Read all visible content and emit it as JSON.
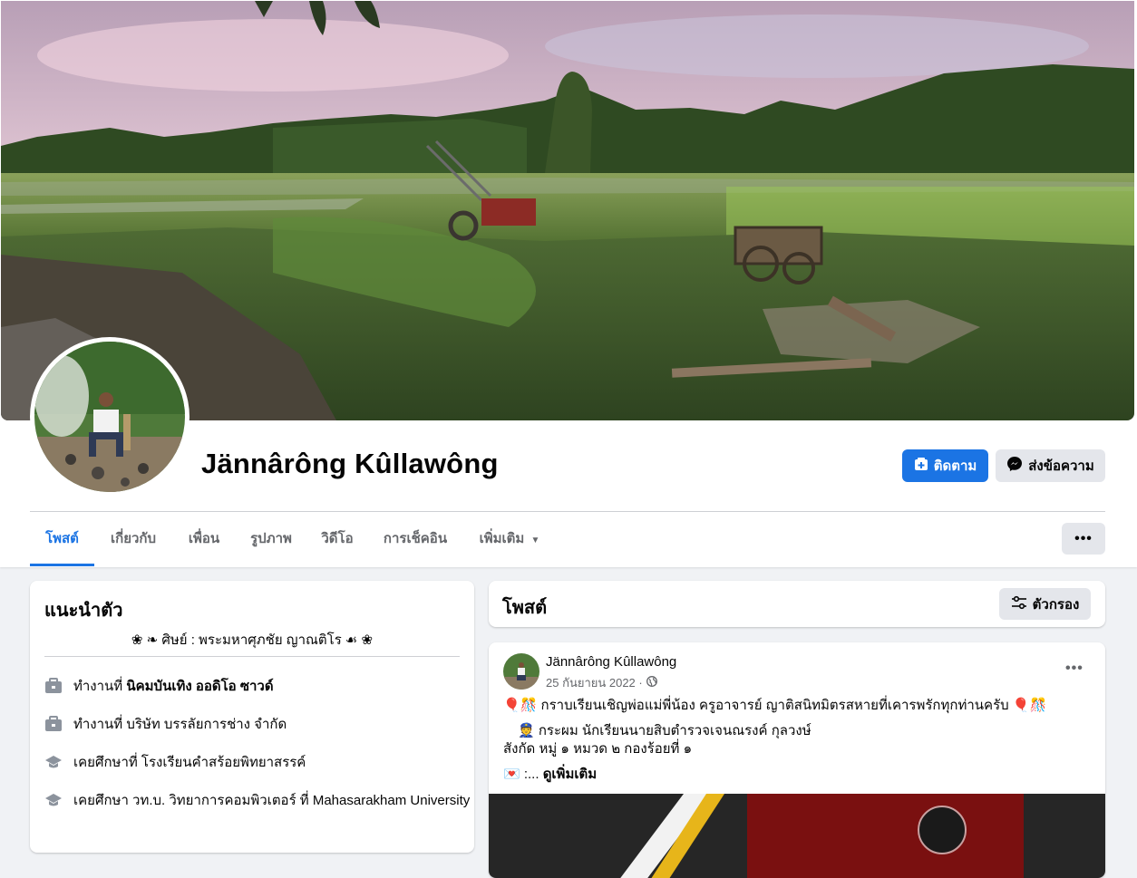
{
  "profile": {
    "name": "Jännârông Kûllawông",
    "follow_label": "ติดตาม",
    "message_label": "ส่งข้อความ"
  },
  "tabs": [
    {
      "label": "โพสต์"
    },
    {
      "label": "เกี่ยวกับ"
    },
    {
      "label": "เพื่อน"
    },
    {
      "label": "รูปภาพ"
    },
    {
      "label": "วิดีโอ"
    },
    {
      "label": "การเช็คอิน"
    },
    {
      "label": "เพิ่มเติม"
    }
  ],
  "more_icon": "more-horizontal-icon",
  "intro": {
    "title": "แนะนำตัว",
    "bio": "❀ ❧ ศิษย์ : พระมหาศุภชัย ญาณติโร ☙ ❀",
    "rows": [
      {
        "icon": "briefcase-icon",
        "prefix": "ทำงานที่ ",
        "bold": "นิคมบันเทิง ออดิโอ ซาวด์"
      },
      {
        "icon": "briefcase-icon",
        "prefix": "ทำงานที่ บริษัท บรรลัยการช่าง จำกัด",
        "bold": ""
      },
      {
        "icon": "graduation-cap-icon",
        "prefix": "เคยศึกษาที่ โรงเรียนคำสร้อยพิทยาสรรค์",
        "bold": ""
      },
      {
        "icon": "graduation-cap-icon",
        "prefix": "เคยศึกษา วท.บ. วิทยาการคอมพิวเตอร์ ที่ Mahasarakham University",
        "bold": ""
      }
    ]
  },
  "posts_header": {
    "title": "โพสต์",
    "filter_label": "ตัวกรอง"
  },
  "post": {
    "author": "Jännârông Kûllawông",
    "date": "25 กันยายน 2022 ·",
    "privacy_icon": "globe-icon",
    "line1": "🎈🎊 กราบเรียนเชิญพ่อแม่พี่น้อง ครูอาจารย์ ญาติสนิทมิตรสหายที่เคารพรักทุกท่านครับ 🎈🎊",
    "line2": "👮 กระผม นักเรียนนายสิบตำรวจเจนณรงค์ กุลวงษ์",
    "line3": "สังกัด หมู่ ๑ หมวด ๒ กองร้อยที่ ๑",
    "line4_prefix": "💌 :...",
    "see_more": "ดูเพิ่มเติม"
  },
  "colors": {
    "accent": "#1b74e4",
    "secondary_button": "#e4e6eb",
    "page_bg": "#f0f2f5",
    "muted_text": "#65676b"
  }
}
